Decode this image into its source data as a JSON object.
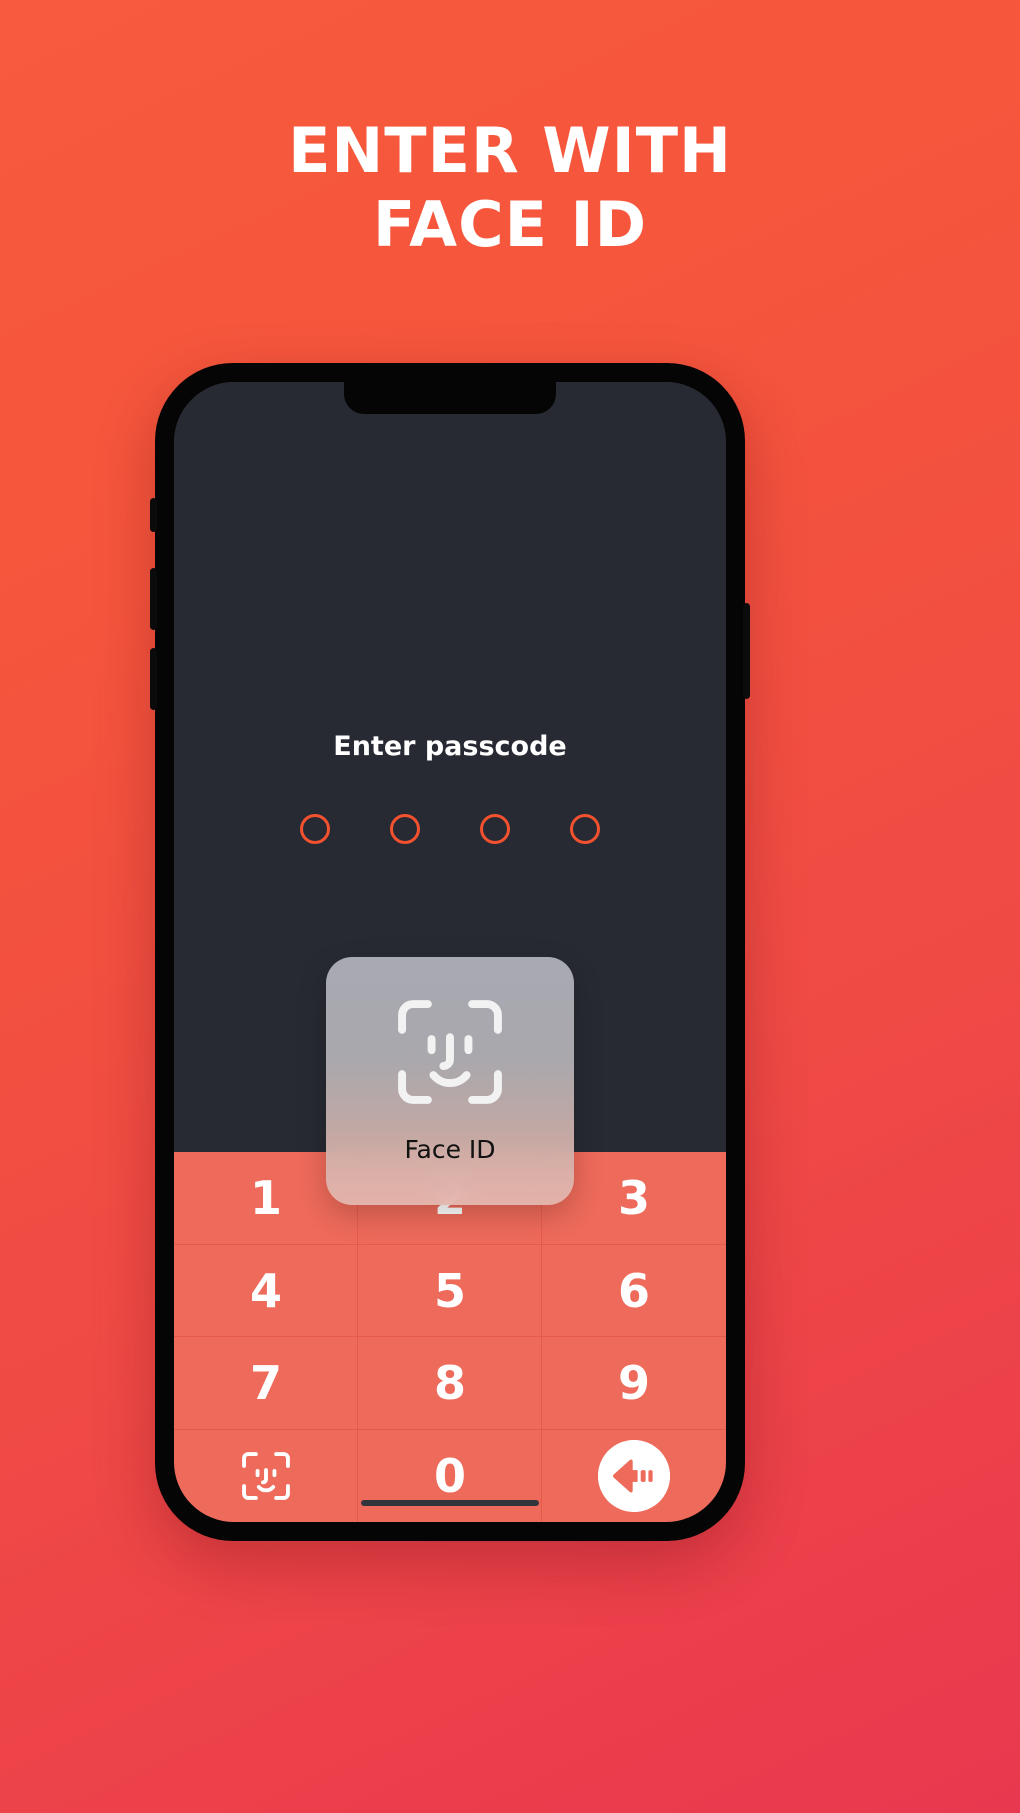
{
  "page": {
    "background_top_color": "#F75A3C",
    "background_bottom_color": "#E8384F"
  },
  "headline": {
    "line1": "ENTER WITH",
    "line2": "FACE ID",
    "color": "#FFFFFF"
  },
  "phone": {
    "frame_color": "#050505",
    "screen_background": "#282A33",
    "keypad_background": "#EE6A5A",
    "accent_color": "#F4512F"
  },
  "lockscreen": {
    "prompt": "Enter passcode",
    "passcode_dots": {
      "count": 4,
      "filled": 0,
      "stroke_color": "#F4512F"
    }
  },
  "faceid_card": {
    "label": "Face ID",
    "icon": "face-id-icon",
    "text_color": "#111111"
  },
  "keypad": {
    "keys": [
      {
        "label": "1",
        "type": "digit",
        "name": "key-1"
      },
      {
        "label": "2",
        "type": "digit",
        "name": "key-2"
      },
      {
        "label": "3",
        "type": "digit",
        "name": "key-3"
      },
      {
        "label": "4",
        "type": "digit",
        "name": "key-4"
      },
      {
        "label": "5",
        "type": "digit",
        "name": "key-5"
      },
      {
        "label": "6",
        "type": "digit",
        "name": "key-6"
      },
      {
        "label": "7",
        "type": "digit",
        "name": "key-7"
      },
      {
        "label": "8",
        "type": "digit",
        "name": "key-8"
      },
      {
        "label": "9",
        "type": "digit",
        "name": "key-9"
      },
      {
        "label": "",
        "type": "faceid",
        "name": "key-faceid",
        "icon": "face-id-icon"
      },
      {
        "label": "0",
        "type": "digit",
        "name": "key-0"
      },
      {
        "label": "",
        "type": "delete",
        "name": "key-delete",
        "icon": "backspace-icon"
      }
    ]
  }
}
